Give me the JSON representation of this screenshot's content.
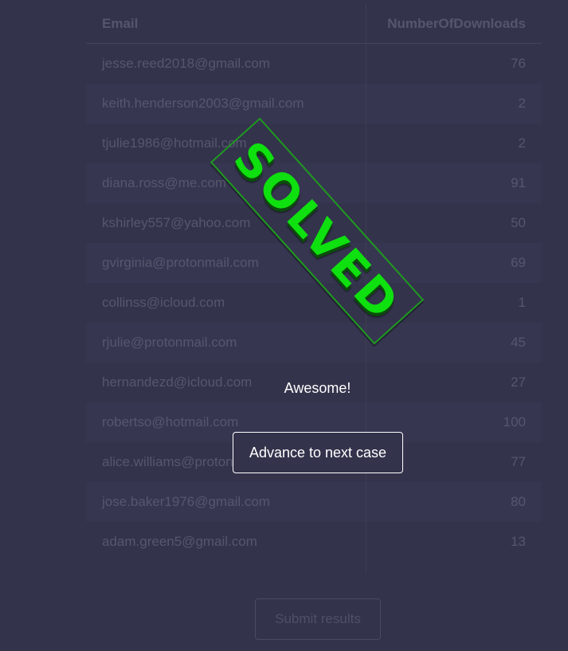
{
  "table": {
    "headers": {
      "email": "Email",
      "downloads": "NumberOfDownloads"
    },
    "rows": [
      {
        "email": "jesse.reed2018@gmail.com",
        "downloads": "76"
      },
      {
        "email": "keith.henderson2003@gmail.com",
        "downloads": "2"
      },
      {
        "email": "tjulie1986@hotmail.com",
        "downloads": "2"
      },
      {
        "email": "diana.ross@me.com",
        "downloads": "91"
      },
      {
        "email": "kshirley557@yahoo.com",
        "downloads": "50"
      },
      {
        "email": "gvirginia@protonmail.com",
        "downloads": "69"
      },
      {
        "email": "collinss@icloud.com",
        "downloads": "1"
      },
      {
        "email": "rjulie@protonmail.com",
        "downloads": "45"
      },
      {
        "email": "hernandezd@icloud.com",
        "downloads": "27"
      },
      {
        "email": "robertso@hotmail.com",
        "downloads": "100"
      },
      {
        "email": "alice.williams@protonmail.com",
        "downloads": "77"
      },
      {
        "email": "jose.baker1976@gmail.com",
        "downloads": "80"
      },
      {
        "email": "adam.green5@gmail.com",
        "downloads": "13"
      }
    ]
  },
  "submit_label": "Submit results",
  "overlay": {
    "stamp_text": "SOLVED",
    "message": "Awesome!",
    "advance_label": "Advance to next case"
  },
  "colors": {
    "background": "#33334c",
    "stamp": "#0fe00f"
  }
}
